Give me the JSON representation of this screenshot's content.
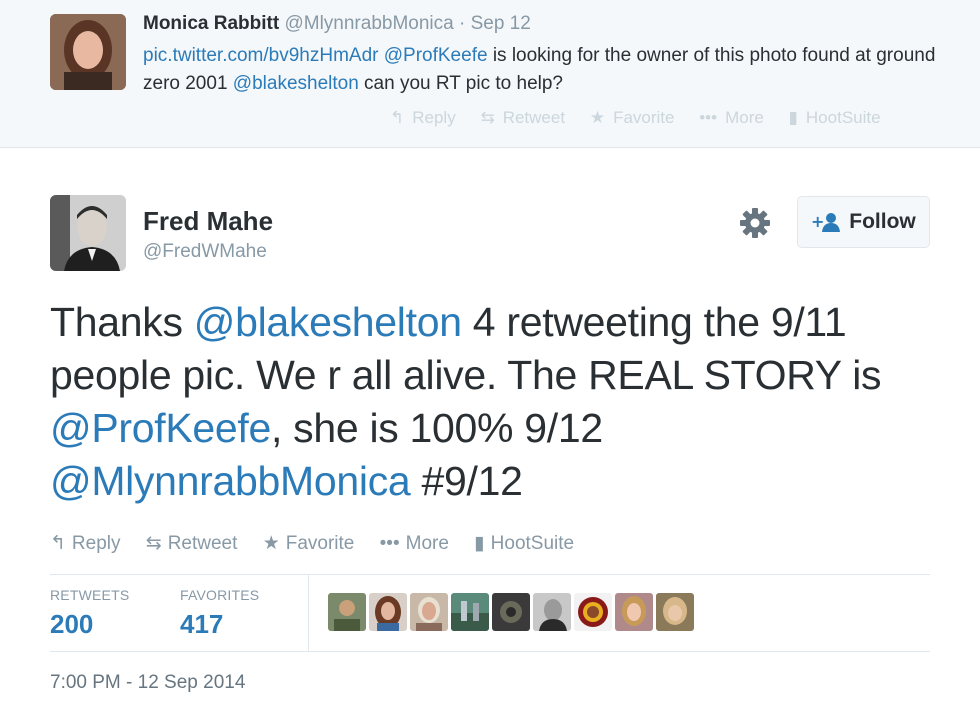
{
  "parent_tweet": {
    "fullname": "Monica Rabbitt",
    "username": "@MlynnrabbMonica",
    "separator": "·",
    "time": "Sep 12",
    "text_segments": [
      {
        "text": "pic.twitter.com/bv9hzHmAdr",
        "link": true
      },
      {
        "text": " ",
        "link": false
      },
      {
        "text": "@ProfKeefe",
        "link": true
      },
      {
        "text": " is looking for the owner of this photo found at ground zero 2001 ",
        "link": false
      },
      {
        "text": "@blakeshelton",
        "link": true
      },
      {
        "text": " can you RT pic to help?",
        "link": false
      }
    ],
    "actions": {
      "reply": "Reply",
      "retweet": "Retweet",
      "favorite": "Favorite",
      "more": "More",
      "hootsuite": "HootSuite"
    }
  },
  "main_tweet": {
    "fullname": "Fred Mahe",
    "username": "@FredWMahe",
    "follow_label": "Follow",
    "text_segments": [
      {
        "text": "Thanks ",
        "link": false
      },
      {
        "text": "@blakeshelton",
        "link": true
      },
      {
        "text": " 4 retweeting the 9/11 people pic. We r all alive. The REAL STORY is ",
        "link": false
      },
      {
        "text": "@ProfKeefe",
        "link": true
      },
      {
        "text": ", she is 100% 9/12 ",
        "link": false
      },
      {
        "text": "@MlynnrabbMonica",
        "link": true
      },
      {
        "text": " #9/12",
        "link": false
      }
    ],
    "actions": {
      "reply": "Reply",
      "retweet": "Retweet",
      "favorite": "Favorite",
      "more": "More",
      "hootsuite": "HootSuite"
    },
    "stats": {
      "retweets_label": "RETWEETS",
      "retweets": "200",
      "favorites_label": "FAVORITES",
      "favorites": "417"
    },
    "timestamp": "7:00 PM - 12 Sep 2014"
  },
  "colors": {
    "link": "#2b7bb9",
    "muted": "#8899a6",
    "text": "#292f33"
  }
}
